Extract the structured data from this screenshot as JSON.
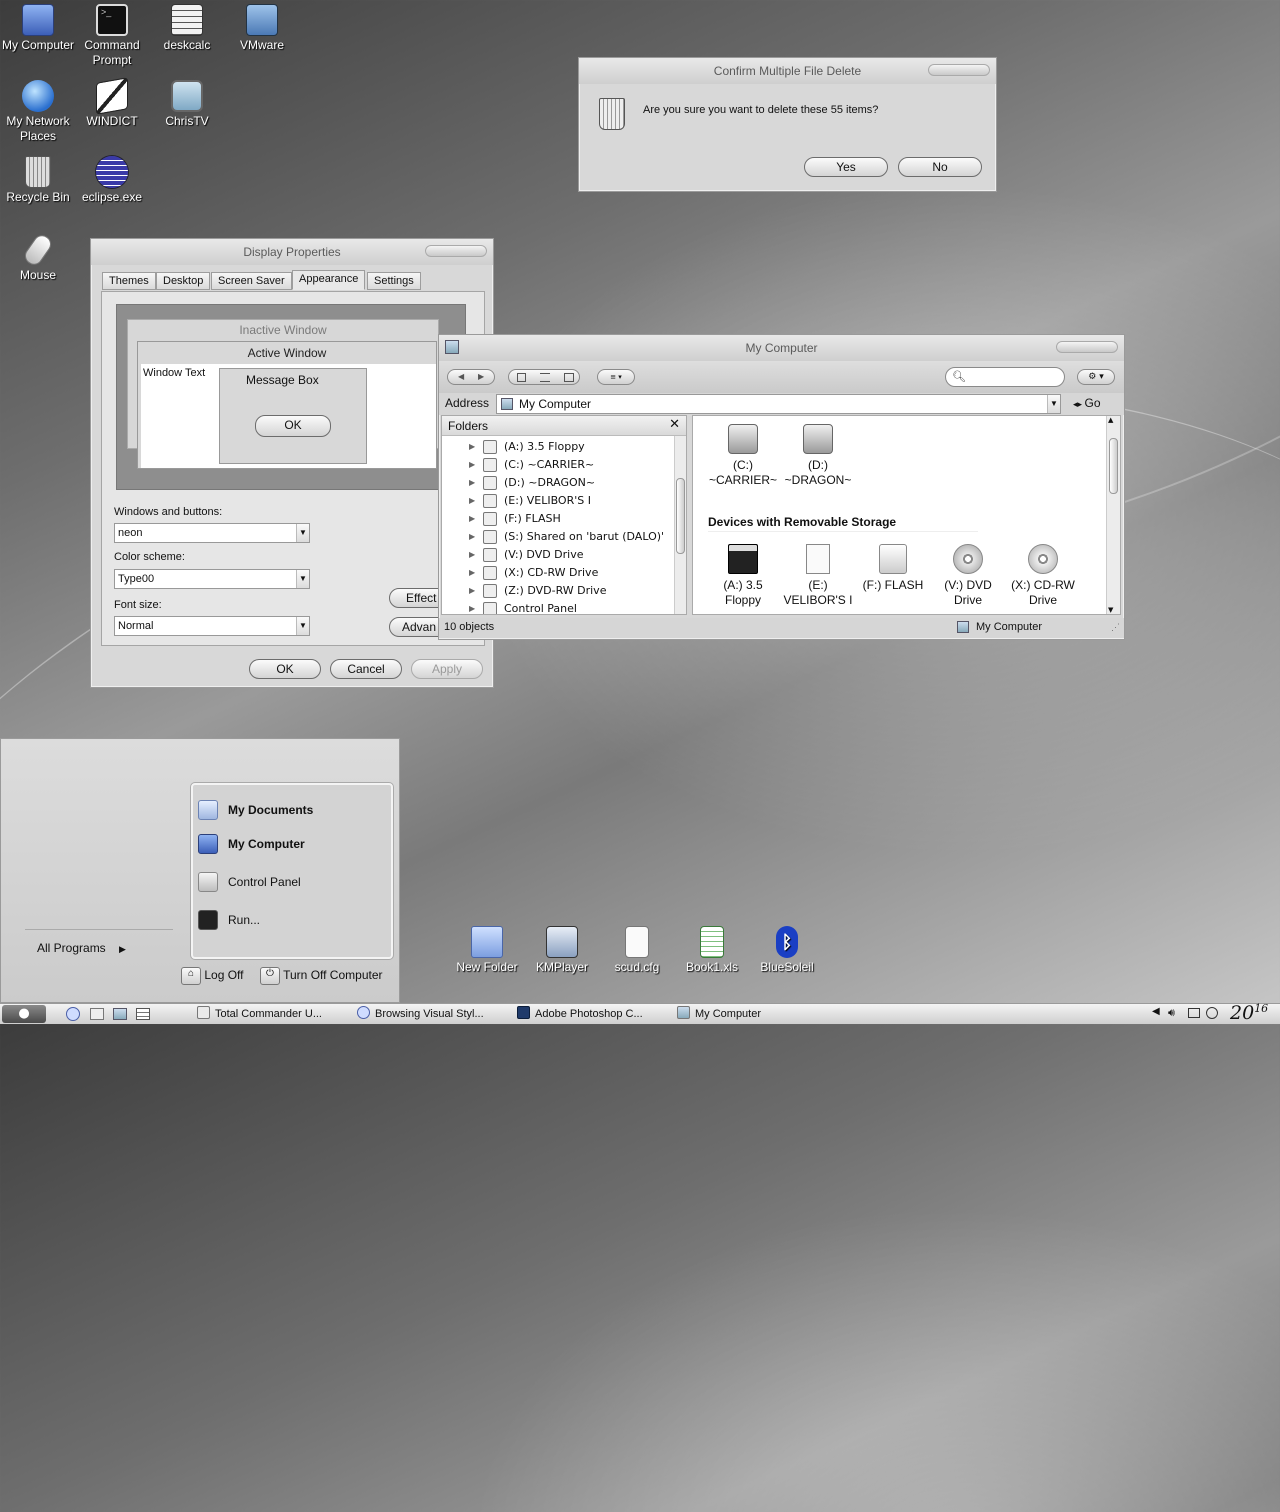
{
  "desktop": {
    "icons": [
      {
        "label": "My Computer",
        "icon": "my-computer-icon"
      },
      {
        "label": "Command Prompt",
        "icon": "command-prompt-icon"
      },
      {
        "label": "deskcalc",
        "icon": "calculator-icon"
      },
      {
        "label": "VMware",
        "icon": "vmware-icon"
      },
      {
        "label": "My Network Places",
        "icon": "network-globe-icon"
      },
      {
        "label": "WINDICT",
        "icon": "dictionary-icon"
      },
      {
        "label": "ChrisTV",
        "icon": "tv-icon"
      },
      {
        "label": "Recycle Bin",
        "icon": "recycle-bin-icon"
      },
      {
        "label": "eclipse.exe",
        "icon": "eclipse-icon"
      },
      {
        "label": "Mouse",
        "icon": "mouse-icon"
      },
      {
        "label": "New Folder",
        "icon": "folder-icon"
      },
      {
        "label": "KMPlayer",
        "icon": "kmplayer-icon"
      },
      {
        "label": "scud.cfg",
        "icon": "config-file-icon"
      },
      {
        "label": "Book1.xls",
        "icon": "spreadsheet-icon"
      },
      {
        "label": "BlueSoleil",
        "icon": "bluetooth-icon"
      }
    ]
  },
  "confirm_dialog": {
    "title": "Confirm Multiple File Delete",
    "message": "Are you sure you want to delete these 55 items?",
    "yes_label": "Yes",
    "no_label": "No"
  },
  "display_properties": {
    "title": "Display Properties",
    "tabs": [
      "Themes",
      "Desktop",
      "Screen Saver",
      "Appearance",
      "Settings"
    ],
    "selected_tab": "Appearance",
    "preview": {
      "inactive_title": "Inactive Window",
      "active_title": "Active Window",
      "window_text": "Window Text",
      "message_box_title": "Message Box",
      "ok_label": "OK"
    },
    "windows_buttons_label": "Windows and buttons:",
    "windows_buttons_value": "neon",
    "color_scheme_label": "Color scheme:",
    "color_scheme_value": "Type00",
    "font_size_label": "Font size:",
    "font_size_value": "Normal",
    "effects_label": "Effect",
    "advanced_label": "Advan",
    "ok_label": "OK",
    "cancel_label": "Cancel",
    "apply_label": "Apply"
  },
  "my_computer": {
    "title": "My Computer",
    "address_label": "Address",
    "address_value": "My Computer",
    "go_label": "Go",
    "folders_label": "Folders",
    "tree": [
      "(A:) 3.5 Floppy",
      "(C:) ~CARRIER~",
      "(D:) ~DRAGON~",
      "(E:) VELIBOR'S I",
      "(F:) FLASH",
      "(S:) Shared on 'barut (DALO)'",
      "(V:) DVD Drive",
      "(X:) CD-RW Drive",
      "(Z:) DVD-RW Drive",
      "Control Panel"
    ],
    "hard_drives": [
      {
        "line1": "(C:)",
        "line2": "~CARRIER~"
      },
      {
        "line1": "(D:)",
        "line2": "~DRAGON~"
      }
    ],
    "removable_header": "Devices with Removable Storage",
    "removable": [
      {
        "line1": "(A:) 3.5",
        "line2": "Floppy",
        "icon": "floppy-icon"
      },
      {
        "line1": "(E:)",
        "line2": "VELIBOR'S I",
        "icon": "removable-disk-icon"
      },
      {
        "line1": "(F:) FLASH",
        "line2": "",
        "icon": "flash-drive-icon"
      },
      {
        "line1": "(V:) DVD",
        "line2": "Drive",
        "icon": "dvd-icon"
      },
      {
        "line1": "(X:) CD-RW",
        "line2": "Drive",
        "icon": "cd-icon"
      }
    ],
    "status_left": "10 objects",
    "status_right": "My Computer"
  },
  "start_menu": {
    "items": [
      {
        "label": "My Documents",
        "bold": true
      },
      {
        "label": "My Computer",
        "bold": true
      },
      {
        "label": "Control Panel",
        "bold": false
      },
      {
        "label": "Run...",
        "bold": false
      }
    ],
    "all_programs": "All Programs",
    "log_off": "Log Off",
    "turn_off": "Turn Off Computer"
  },
  "taskbar": {
    "tasks": [
      "Total Commander U...",
      "Browsing Visual Styl...",
      "Adobe Photoshop C...",
      "My Computer"
    ],
    "clock_main": "20",
    "clock_small": "16"
  }
}
